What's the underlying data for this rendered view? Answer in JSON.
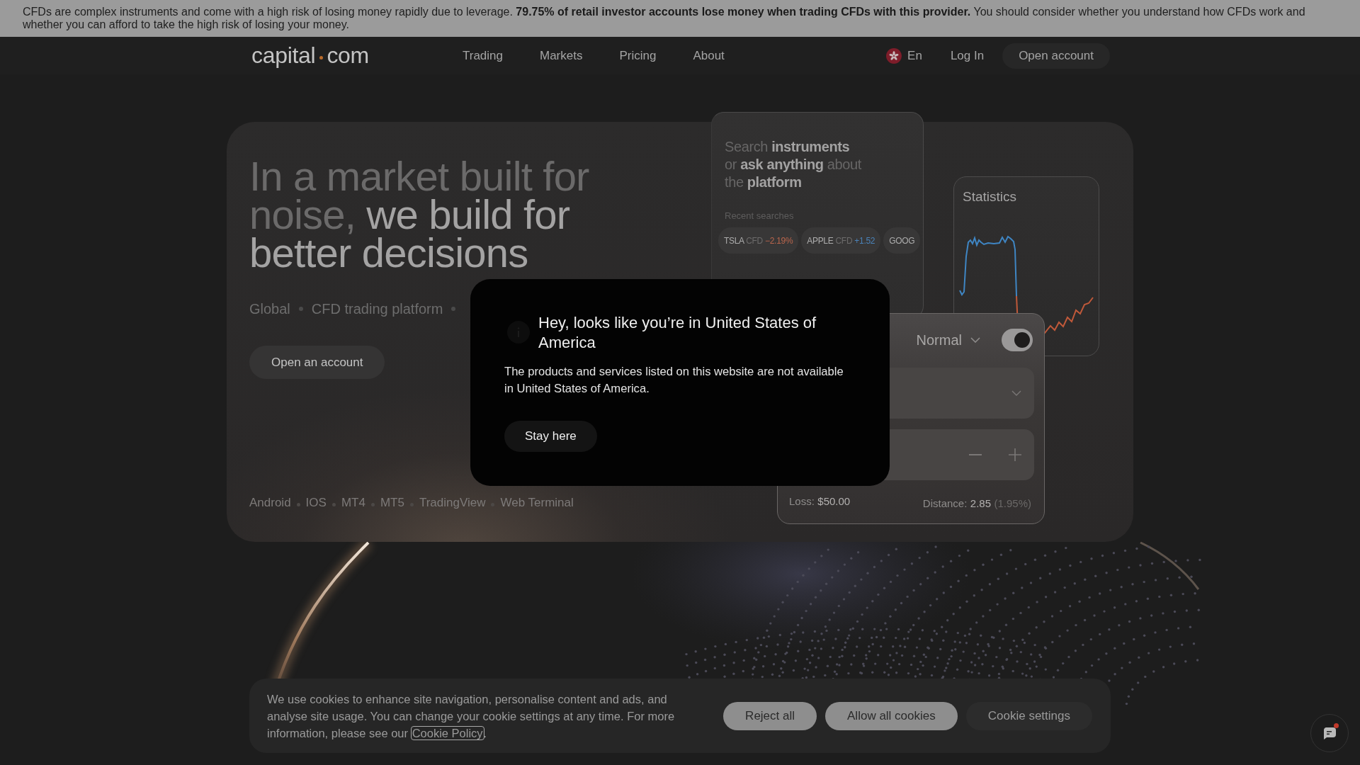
{
  "risk_warning": "CFDs are complex instruments and come with a high risk of losing money rapidly due to leverage. **79.75% of retail investor accounts lose money when trading CFDs with this provider.** You should consider whether you understand how CFDs work and whether you can afford to take the high risk of losing your money.",
  "nav": {
    "logo": {
      "left": "capital",
      "right": "com"
    },
    "links": [
      "Trading",
      "Markets",
      "Pricing",
      "About"
    ],
    "language": "En",
    "login": "Log In",
    "cta": "Open account"
  },
  "hero": {
    "headline": {
      "muted": "In a market built for noise,",
      "strong": "we build for better decisions"
    },
    "tagline": [
      "Global",
      "CFD trading platform"
    ],
    "cta": "Open an account",
    "platforms": [
      "Android",
      "IOS",
      "MT4",
      "MT5",
      "TradingView",
      "Web Terminal"
    ]
  },
  "search_card": {
    "prompt": "Search **instruments** or **ask anything** about the **platform**",
    "recent_label": "Recent searches",
    "recent": [
      {
        "ticker": "TSLA",
        "type": "CFD",
        "change": "−2.19%",
        "color": "#b9654c"
      },
      {
        "ticker": "APPLE",
        "type": "CFD",
        "change": "+1.52",
        "color": "#4a82b8"
      },
      {
        "ticker": "GOOG"
      }
    ]
  },
  "statistics_card": {
    "title": "Statistics"
  },
  "order_card": {
    "mode": "Normal",
    "toggle_on": true,
    "loss_label": "Loss:",
    "loss_value": "$50.00",
    "distance_label": "Distance:",
    "distance_value": "2.85",
    "distance_percent": "(1.95%)"
  },
  "location_modal": {
    "title": "Hey, looks like you’re in United States of America",
    "body": "The products and services listed on this website are not available in United States of America.",
    "button": "Stay here"
  },
  "cookie_banner": {
    "text": "We use cookies to enhance site navigation, personalise content and ads, and analyse site usage. You can change your cookie settings at any time. For more information, please see our",
    "link": "Cookie Policy",
    "text_end": ".",
    "buttons": [
      {
        "label": "Reject all",
        "kind": "filled"
      },
      {
        "label": "Allow all cookies",
        "kind": "filled"
      },
      {
        "label": "Cookie settings",
        "kind": "ghost"
      }
    ]
  },
  "chat": {
    "unread": true
  }
}
